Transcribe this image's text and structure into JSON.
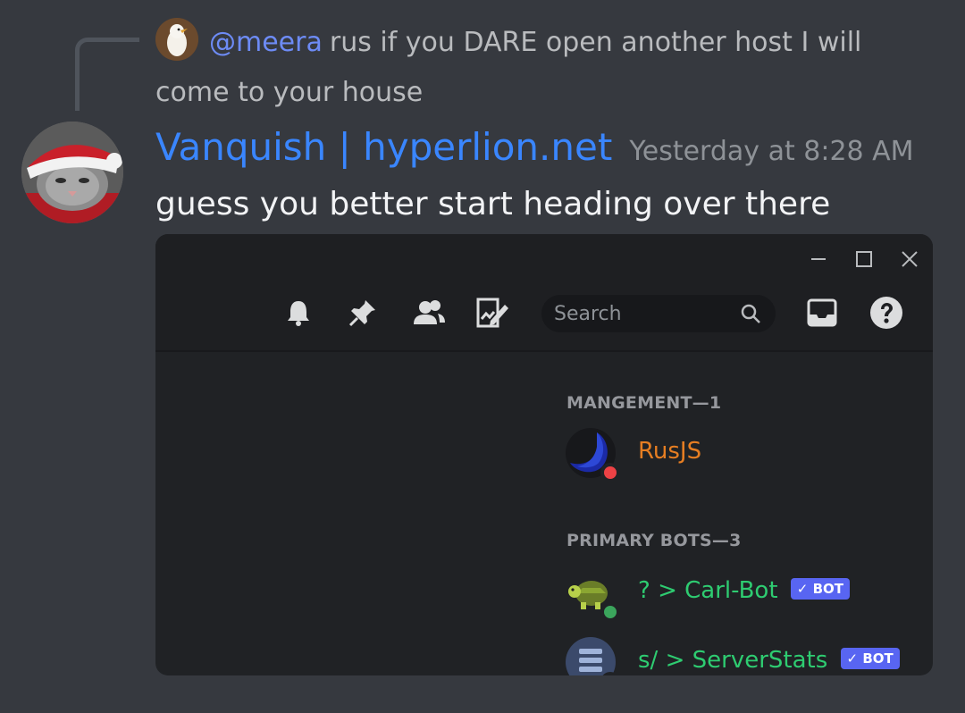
{
  "reply": {
    "mention": "@meera",
    "text": "rus if you DARE open another host I will come to your house"
  },
  "message": {
    "author": "Vanquish | hyperlion.net",
    "timestamp": "Yesterday at 8:28 AM",
    "text": "guess you better start heading over there",
    "author_color": "#3a86ff"
  },
  "embed": {
    "toolbar": {
      "icons": [
        "bell-icon",
        "pin-icon",
        "members-icon",
        "threads-icon",
        "inbox-icon",
        "help-icon"
      ],
      "search_placeholder": "Search"
    },
    "sections": [
      {
        "title": "MANGEMENT—1",
        "members": [
          {
            "name": "RusJS",
            "color": "#e67e22",
            "status": "dnd",
            "bot": false
          }
        ]
      },
      {
        "title": "PRIMARY BOTS—3",
        "members": [
          {
            "name": "? > Carl-Bot",
            "color": "#2ecc71",
            "status": "online",
            "bot": true,
            "tag": "✓ BOT"
          },
          {
            "name": "s/ > ServerStats",
            "color": "#2ecc71",
            "status": "online",
            "bot": true,
            "tag": "✓ BOT"
          }
        ]
      }
    ]
  }
}
